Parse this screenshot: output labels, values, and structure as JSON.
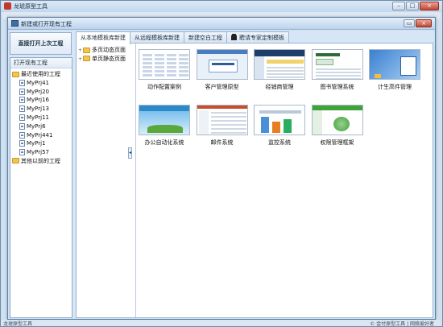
{
  "app": {
    "title": "龙琥原型工具"
  },
  "window_buttons": {
    "minimize": "–",
    "maximize": "□",
    "close": "×"
  },
  "dialog": {
    "title": "新建或打开现有工程",
    "restore": "▭",
    "close": "×"
  },
  "left": {
    "recent_button": "直接打开上次工程",
    "panel_title": "打开现有工程",
    "groups": [
      {
        "label": "最近使用的工程",
        "items": [
          "MyPrj41",
          "MyPrj20",
          "MyPrj16",
          "MyPrj13",
          "MyPrj11",
          "MyPrj6",
          "MyPrj441",
          "MyPrj1",
          "MyPrj57"
        ]
      },
      {
        "label": "其他以前的工程",
        "items": []
      }
    ]
  },
  "tabs": [
    "从本地模板库新建",
    "从远程模板库新建",
    "新建空白工程",
    "聘请专家定制模板"
  ],
  "template_tree": [
    {
      "label": "多页动态页面",
      "toggle": "+"
    },
    {
      "label": "单页静态页面",
      "toggle": "+"
    }
  ],
  "templates": [
    {
      "label": "动作配置案例",
      "style": "form"
    },
    {
      "label": "客户管理原型",
      "style": "blue"
    },
    {
      "label": "经销商管理",
      "style": "dark"
    },
    {
      "label": "图书管理系统",
      "style": "book"
    },
    {
      "label": "计生高件管理",
      "style": "windows"
    },
    {
      "label": "办公自动化系统",
      "style": "oa"
    },
    {
      "label": "邮件系统",
      "style": "mail"
    },
    {
      "label": "监控系统",
      "style": "monitor"
    },
    {
      "label": "权限管理框架",
      "style": "green"
    }
  ],
  "splitter": {
    "grip": "◂"
  },
  "statusbar": {
    "left": "龙琥原型工具",
    "right": "© 金付原型工具 | 网络爱好者"
  },
  "colors": {
    "accent": "#3f6ea6",
    "selected_folder": "#f1c54f"
  }
}
